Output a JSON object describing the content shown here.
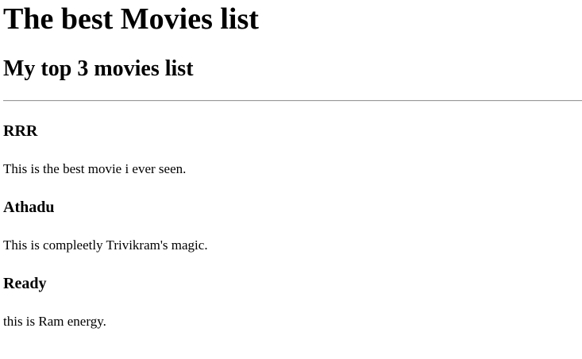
{
  "page": {
    "title": "The best Movies list",
    "subtitle": "My top 3 movies list"
  },
  "movies": [
    {
      "title": "RRR",
      "description": "This is the best movie i ever seen."
    },
    {
      "title": "Athadu",
      "description": "This is compleetly Trivikram's magic."
    },
    {
      "title": "Ready",
      "description": "this is Ram energy."
    }
  ]
}
